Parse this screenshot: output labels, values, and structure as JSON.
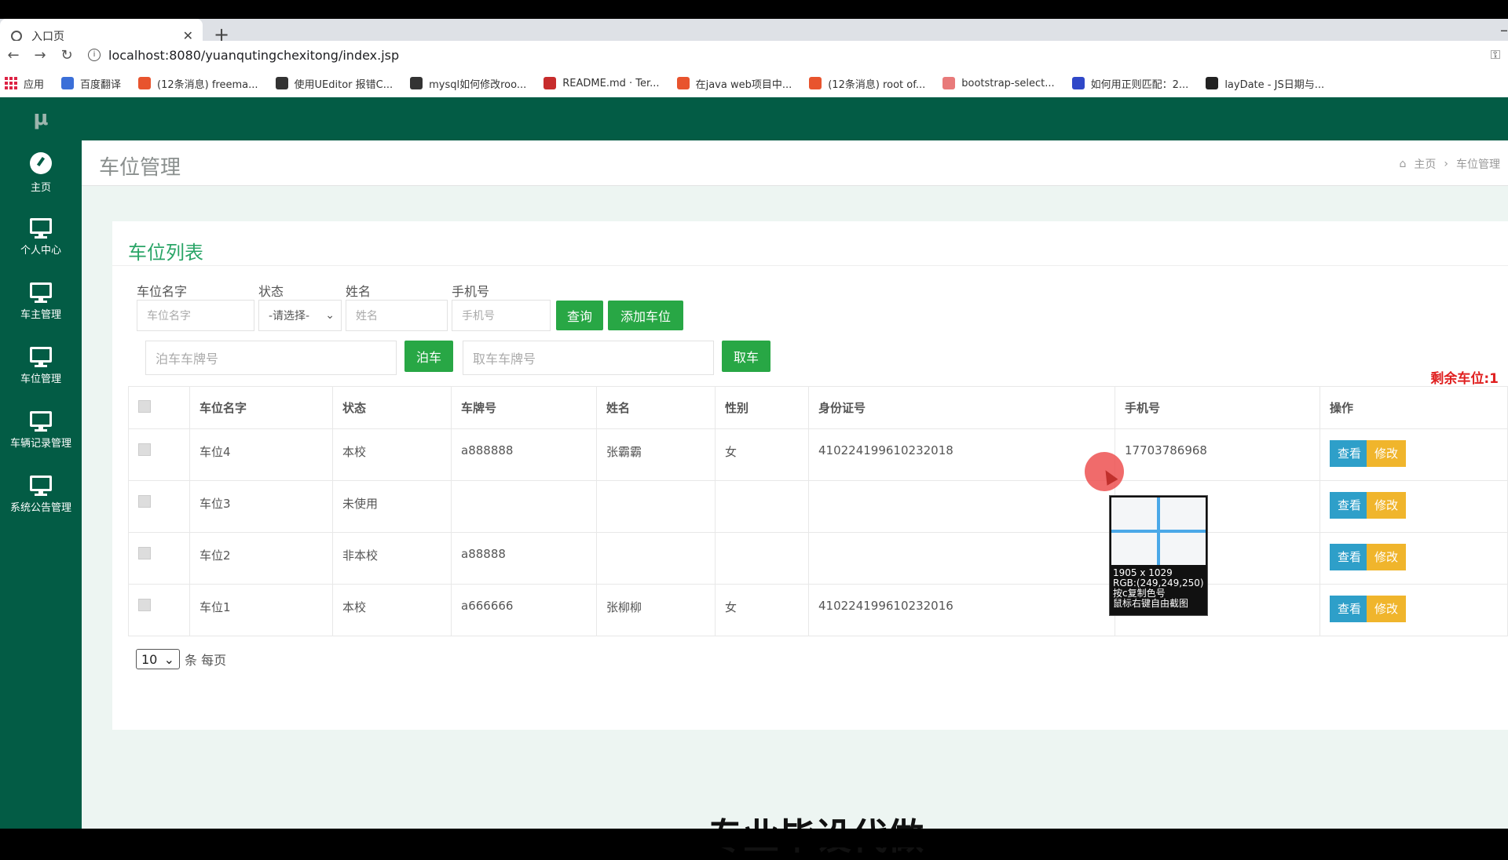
{
  "browser": {
    "tab_title": "入口页",
    "new_tab": "+",
    "url": "localhost:8080/yuanqutingchexitong/index.jsp",
    "bookmarks": [
      {
        "label": "应用",
        "color": "#d24"
      },
      {
        "label": "百度翻译",
        "color": "#3b6fd8"
      },
      {
        "label": "(12条消息) freema...",
        "color": "#e8542e"
      },
      {
        "label": "使用UEditor 报错C...",
        "color": "#333"
      },
      {
        "label": "mysql如何修改roo...",
        "color": "#333"
      },
      {
        "label": "README.md · Ter...",
        "color": "#c72c2c"
      },
      {
        "label": "在java web项目中...",
        "color": "#e8542e"
      },
      {
        "label": "(12条消息) root of...",
        "color": "#e8542e"
      },
      {
        "label": "bootstrap-select...",
        "color": "#e87a7a"
      },
      {
        "label": "如何用正则匹配：2...",
        "color": "#3048c8"
      },
      {
        "label": "layDate - JS日期与...",
        "color": "#222"
      }
    ]
  },
  "sidebar": {
    "logo": "μ",
    "items": [
      {
        "label": "主页",
        "icon": "dashboard-icon"
      },
      {
        "label": "个人中心",
        "icon": "monitor-icon"
      },
      {
        "label": "车主管理",
        "icon": "monitor-icon"
      },
      {
        "label": "车位管理",
        "icon": "monitor-icon"
      },
      {
        "label": "车辆记录管理",
        "icon": "monitor-icon"
      },
      {
        "label": "系统公告管理",
        "icon": "monitor-icon"
      }
    ]
  },
  "header": {
    "title": "车位管理",
    "breadcrumb_home": "主页",
    "breadcrumb_sep": "›",
    "breadcrumb_current": "车位管理"
  },
  "card": {
    "title": "车位列表",
    "filters": {
      "name_label": "车位名字",
      "name_placeholder": "车位名字",
      "status_label": "状态",
      "status_value": "-请选择-",
      "owner_label": "姓名",
      "owner_placeholder": "姓名",
      "phone_label": "手机号",
      "phone_placeholder": "手机号",
      "search_btn": "查询",
      "add_btn": "添加车位"
    },
    "park": {
      "park_placeholder": "泊车车牌号",
      "park_btn": "泊车",
      "take_placeholder": "取车车牌号",
      "take_btn": "取车"
    },
    "remaining": "剩余车位:1",
    "table": {
      "headers": [
        "车位名字",
        "状态",
        "车牌号",
        "姓名",
        "性别",
        "身份证号",
        "手机号",
        "操作"
      ],
      "rows": [
        {
          "name": "车位4",
          "status": "本校",
          "plate": "a888888",
          "owner": "张霸霸",
          "gender": "女",
          "id": "410224199610232018",
          "phone": "17703786968"
        },
        {
          "name": "车位3",
          "status": "未使用",
          "plate": "",
          "owner": "",
          "gender": "",
          "id": "",
          "phone": ""
        },
        {
          "name": "车位2",
          "status": "非本校",
          "plate": "a88888",
          "owner": "",
          "gender": "",
          "id": "",
          "phone": ""
        },
        {
          "name": "车位1",
          "status": "本校",
          "plate": "a666666",
          "owner": "张柳柳",
          "gender": "女",
          "id": "410224199610232016",
          "phone": ""
        }
      ],
      "view_btn": "查看",
      "edit_btn": "修改"
    },
    "pagination": {
      "per_page_value": "10",
      "per_page_suffix": "条 每页"
    }
  },
  "picker": {
    "line1": "1905 x 1029",
    "line2": "RGB:(249,249,250)",
    "line3": "按c复制色号",
    "line4": "鼠标右键自由截图"
  },
  "watermark": "专业毕设代做",
  "colors": {
    "sidebar": "#035c45",
    "accent": "#28a745",
    "title_green": "#2aa567",
    "remaining_red": "#e02020",
    "view_btn": "#2e9fc9",
    "edit_btn": "#f0b52c"
  }
}
